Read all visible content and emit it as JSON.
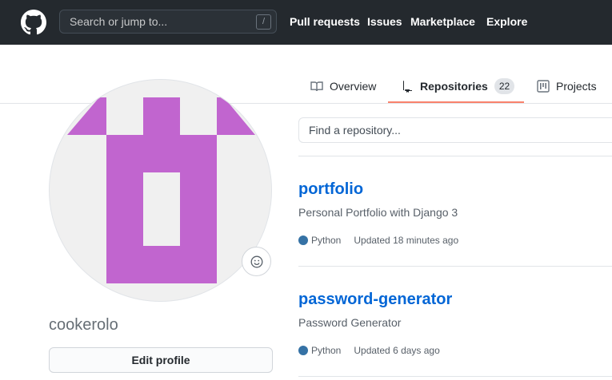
{
  "header": {
    "search_placeholder": "Search or jump to...",
    "search_shortcut": "/",
    "nav": [
      "Pull requests",
      "Issues",
      "Marketplace",
      "Explore"
    ]
  },
  "tabs": [
    {
      "label": "Overview",
      "icon": "book-icon"
    },
    {
      "label": "Repositories",
      "icon": "repo-icon",
      "count": "22",
      "active": true
    },
    {
      "label": "Projects",
      "icon": "project-icon"
    }
  ],
  "profile": {
    "username": "cookerolo",
    "edit_label": "Edit profile",
    "avatar_color": "#c165cf"
  },
  "repo_search": {
    "placeholder": "Find a repository..."
  },
  "repos": [
    {
      "name": "portfolio",
      "description": "Personal Portfolio with Django 3",
      "language": "Python",
      "language_color": "#3572A5",
      "updated": "Updated 18 minutes ago"
    },
    {
      "name": "password-generator",
      "description": "Password Generator",
      "language": "Python",
      "language_color": "#3572A5",
      "updated": "Updated 6 days ago"
    }
  ],
  "colors": {
    "header_bg": "#24292e",
    "link": "#0366d6",
    "tab_active_underline": "#f9826c"
  }
}
